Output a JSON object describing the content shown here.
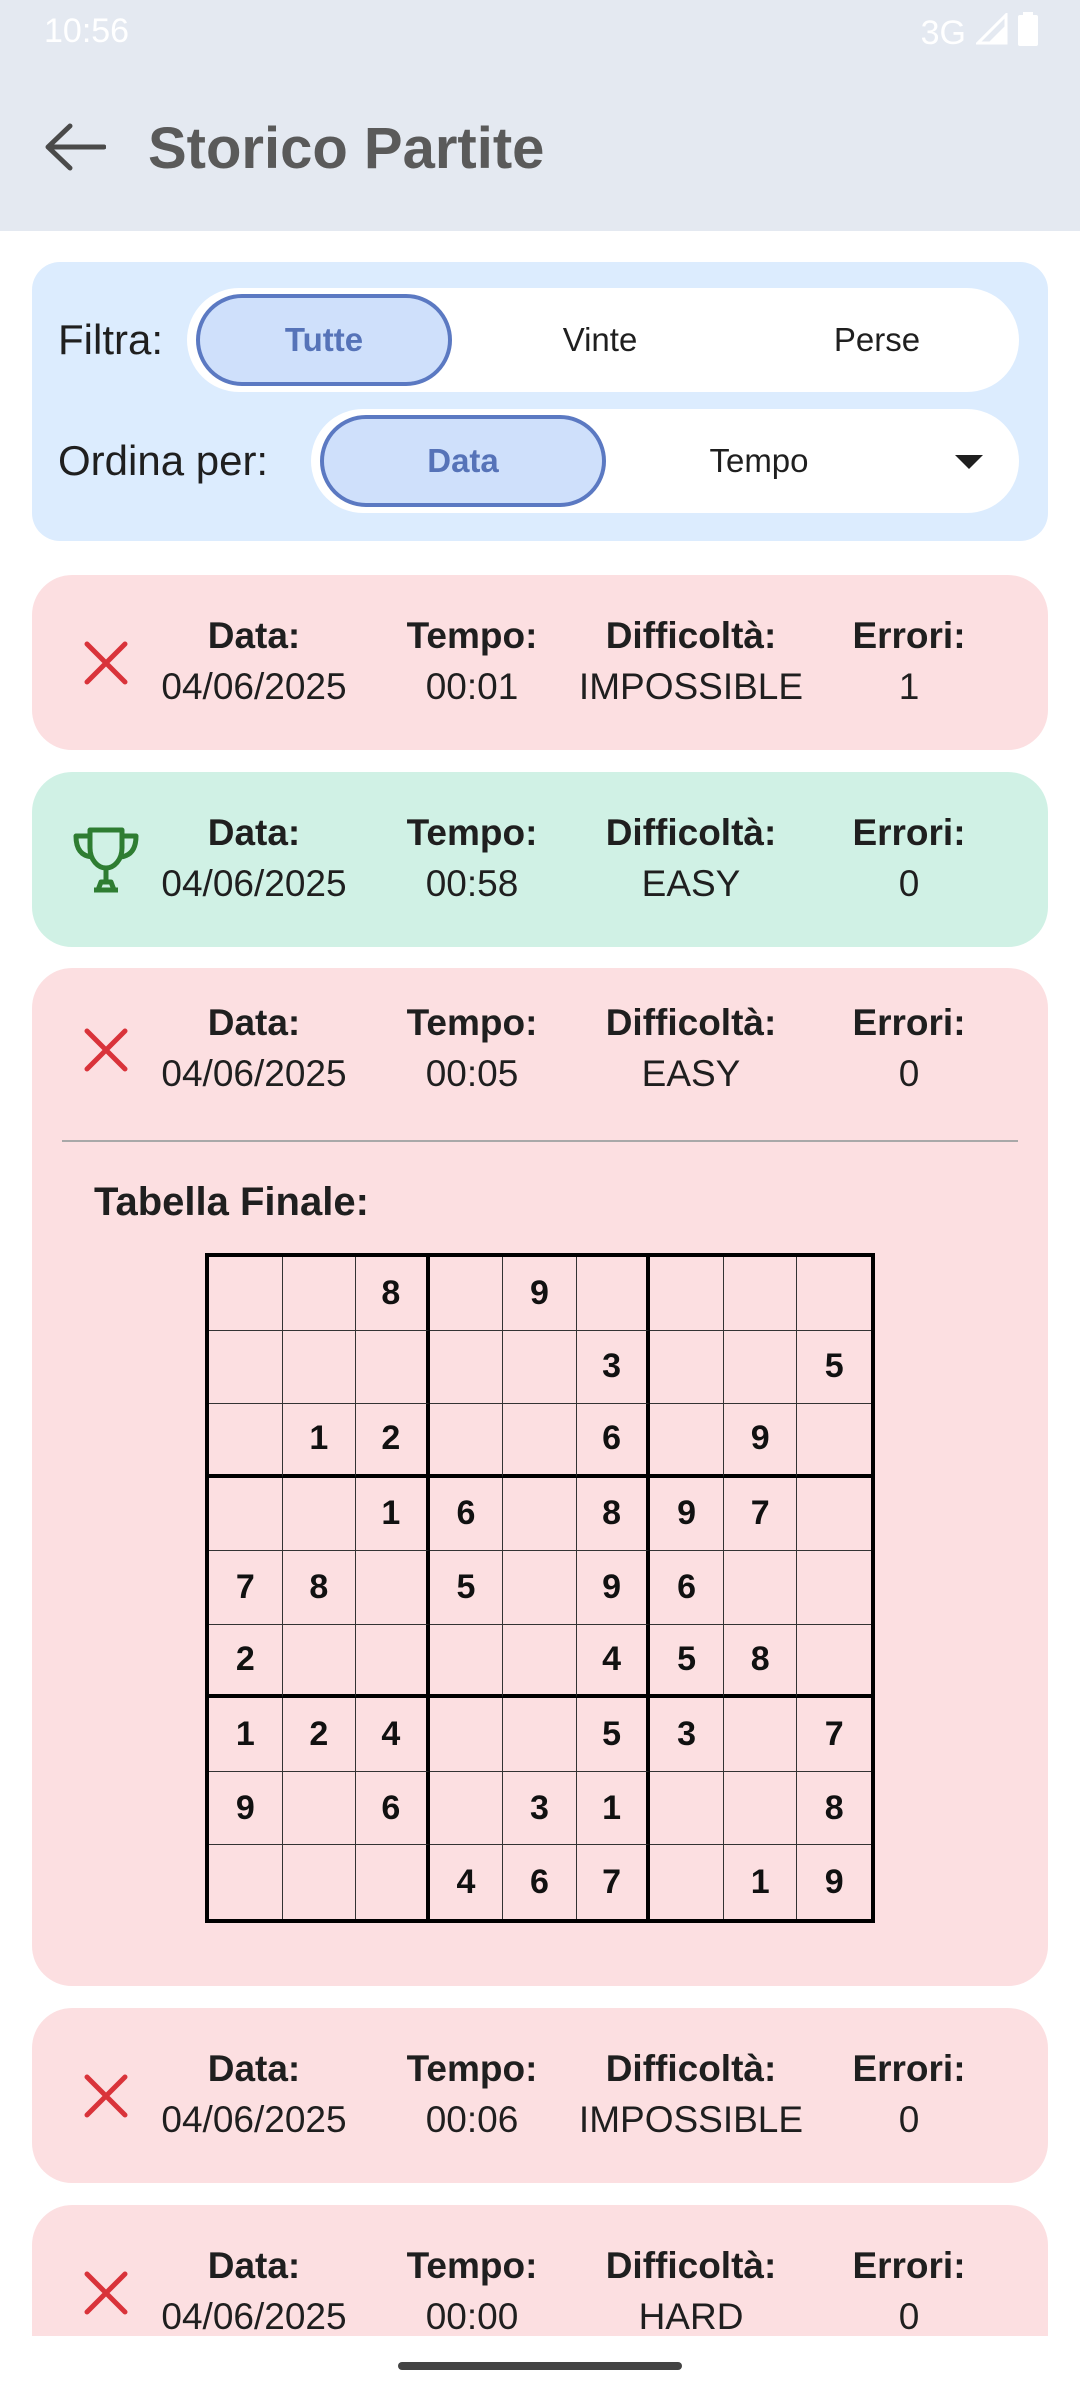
{
  "status_bar": {
    "time": "10:56",
    "network": "3G"
  },
  "app_bar": {
    "title": "Storico Partite",
    "back_icon": "arrow-left-icon"
  },
  "filter": {
    "label": "Filtra:",
    "options": [
      "Tutte",
      "Vinte",
      "Perse"
    ],
    "selected": "Tutte"
  },
  "sort": {
    "label": "Ordina per:",
    "options": [
      "Data",
      "Tempo"
    ],
    "selected": "Data"
  },
  "columns": {
    "date": "Data:",
    "time": "Tempo:",
    "difficulty": "Difficoltà:",
    "errors": "Errori:"
  },
  "games": [
    {
      "result": "lost",
      "icon": "close-icon",
      "date": "04/06/2025",
      "time": "00:01",
      "difficulty": "IMPOSSIBLE",
      "errors": "1"
    },
    {
      "result": "won",
      "icon": "trophy-icon",
      "date": "04/06/2025",
      "time": "00:58",
      "difficulty": "EASY",
      "errors": "0"
    },
    {
      "result": "lost",
      "icon": "close-icon",
      "date": "04/06/2025",
      "time": "00:05",
      "difficulty": "EASY",
      "errors": "0",
      "expanded": true
    },
    {
      "result": "lost",
      "icon": "close-icon",
      "date": "04/06/2025",
      "time": "00:06",
      "difficulty": "IMPOSSIBLE",
      "errors": "0"
    },
    {
      "result": "lost",
      "icon": "close-icon",
      "date": "04/06/2025",
      "time": "00:00",
      "difficulty": "HARD",
      "errors": "0"
    }
  ],
  "final_board": {
    "title": "Tabella Finale:",
    "grid": [
      [
        "",
        "",
        "8",
        "",
        "9",
        "",
        "",
        "",
        ""
      ],
      [
        "",
        "",
        "",
        "",
        "",
        "3",
        "",
        "",
        "5"
      ],
      [
        "",
        "1",
        "2",
        "",
        "",
        "6",
        "",
        "9",
        ""
      ],
      [
        "",
        "",
        "1",
        "6",
        "",
        "8",
        "9",
        "7",
        ""
      ],
      [
        "7",
        "8",
        "",
        "5",
        "",
        "9",
        "6",
        "",
        ""
      ],
      [
        "2",
        "",
        "",
        "",
        "",
        "4",
        "5",
        "8",
        ""
      ],
      [
        "1",
        "2",
        "4",
        "",
        "",
        "5",
        "3",
        "",
        "7"
      ],
      [
        "9",
        "",
        "6",
        "",
        "3",
        "1",
        "",
        "",
        "8"
      ],
      [
        "",
        "",
        "",
        "4",
        "6",
        "7",
        "",
        "1",
        "9"
      ]
    ]
  },
  "colors": {
    "lost_card": "#fcdfe1",
    "won_card": "#d0f1e5",
    "accent": "#5b79c2",
    "lost_icon": "#d9333a",
    "won_icon": "#2e7d32"
  }
}
